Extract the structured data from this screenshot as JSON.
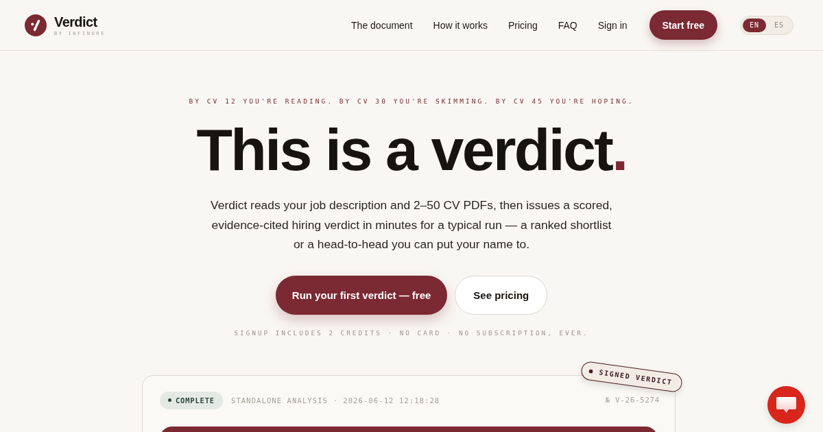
{
  "brand": {
    "name": "Verdict",
    "byline": "BY INFINURE"
  },
  "nav": {
    "links": [
      "The document",
      "How it works",
      "Pricing",
      "FAQ",
      "Sign in"
    ],
    "cta": "Start free",
    "languages": [
      {
        "label": "EN",
        "selected": true
      },
      {
        "label": "ES",
        "selected": false
      }
    ]
  },
  "hero": {
    "eyebrow": "BY CV 12 YOU'RE READING. BY CV 30 YOU'RE SKIMMING. BY CV 45 YOU'RE HOPING.",
    "headline": {
      "text": "This is a verdict",
      "accent": "."
    },
    "lede": "Verdict reads your job description and 2–50 CV PDFs, then issues a scored, evidence-cited hiring verdict in minutes for a typical run — a ranked shortlist or a head-to-head you can put your name to.",
    "buttons": [
      {
        "label": "Run your first verdict — free",
        "kind": "primary"
      },
      {
        "label": "See pricing",
        "kind": "secondary"
      }
    ],
    "note": "SIGNUP INCLUDES 2 CREDITS · NO CARD · NO SUBSCRIPTION, EVER."
  },
  "verdict_card": {
    "status": {
      "label": "COMPLETE",
      "kind": "complete"
    },
    "meta": "STANDALONE ANALYSIS · 2026-06-12 12:18:28",
    "number": "№ V-26-5274",
    "stamp": "SIGNED VERDICT"
  }
}
